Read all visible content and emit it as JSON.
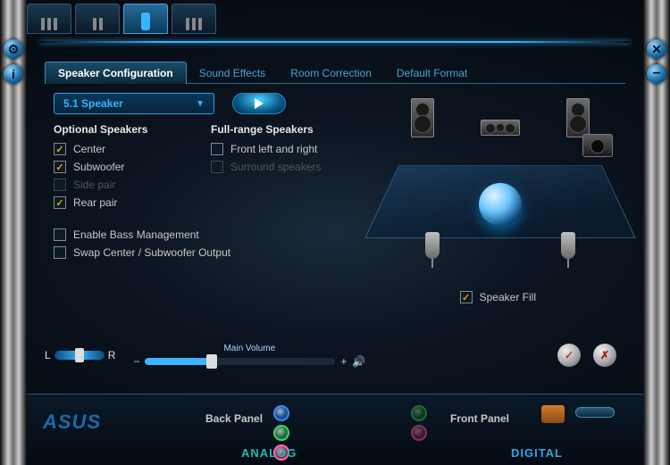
{
  "tabs": {
    "config": "Speaker Configuration",
    "effects": "Sound Effects",
    "room": "Room Correction",
    "format": "Default Format"
  },
  "dropdown": {
    "selected": "5.1 Speaker"
  },
  "headings": {
    "optional": "Optional Speakers",
    "fullrange": "Full-range Speakers"
  },
  "opt": {
    "center": "Center",
    "sub": "Subwoofer",
    "side": "Side pair",
    "rear": "Rear pair"
  },
  "fr": {
    "front": "Front left and right",
    "surround": "Surround speakers"
  },
  "extra": {
    "bass": "Enable Bass Management",
    "swap": "Swap Center / Subwoofer Output"
  },
  "fill": "Speaker Fill",
  "vol": {
    "l": "L",
    "r": "R",
    "minus": "−",
    "plus": "+",
    "label": "Main Volume"
  },
  "footer": {
    "brand": "ASUS",
    "back": "Back Panel",
    "front": "Front Panel",
    "analog": "ANALOG",
    "digital": "DIGITAL"
  },
  "icons": {
    "info": "i",
    "close": "✕",
    "min": "−",
    "gear": "⚙",
    "ok": "✓",
    "cancel": "✗",
    "snd": "🔊"
  }
}
